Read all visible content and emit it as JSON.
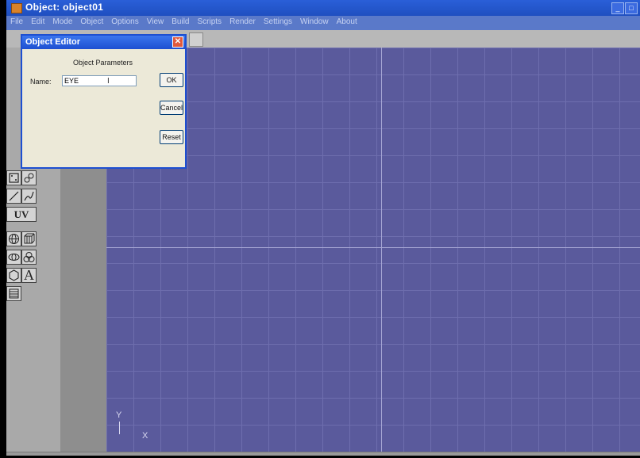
{
  "window": {
    "title": "Object: object01"
  },
  "menu": [
    "File",
    "Edit",
    "Mode",
    "Object",
    "Options",
    "View",
    "Build",
    "Scripts",
    "Render",
    "Settings",
    "Window",
    "About"
  ],
  "tools": {
    "uv_label": "UV",
    "text_tool_label": "A"
  },
  "viewport": {
    "axis_y": "Y",
    "axis_x": "X"
  },
  "dialog": {
    "title": "Object Editor",
    "heading": "Object Parameters",
    "name_label": "Name:",
    "name_value": "EYE",
    "ok": "OK",
    "cancel": "Cancel",
    "reset": "Reset"
  },
  "colors": {
    "viewport_bg": "#5a5a9c",
    "grid": "#6e6eae",
    "titlebar": "#1f4fc0"
  }
}
